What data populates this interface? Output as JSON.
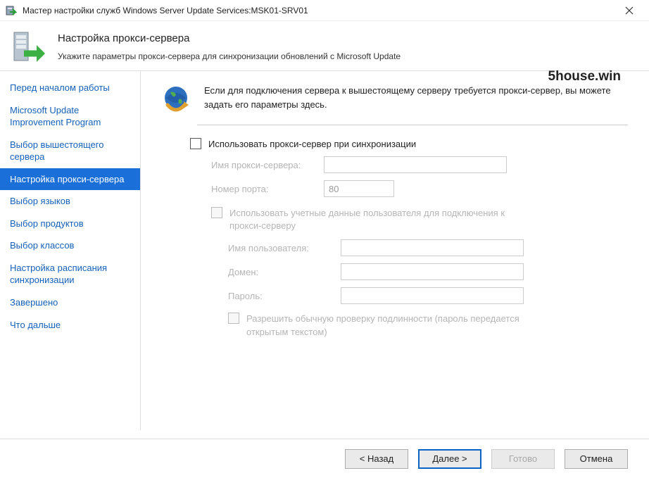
{
  "titlebar": {
    "title": "Мастер настройки служб Windows Server Update Services:MSK01-SRV01"
  },
  "header": {
    "page_title": "Настройка прокси-сервера",
    "page_subtitle": "Укажите параметры прокси-сервера для синхронизации обновлений с Microsoft Update"
  },
  "watermark": "5house.win",
  "sidebar": {
    "items": [
      {
        "label": "Перед началом работы"
      },
      {
        "label": "Microsoft Update Improvement Program"
      },
      {
        "label": "Выбор вышестоящего сервера"
      },
      {
        "label": "Настройка прокси-сервера",
        "selected": true
      },
      {
        "label": "Выбор языков"
      },
      {
        "label": "Выбор продуктов"
      },
      {
        "label": "Выбор классов"
      },
      {
        "label": "Настройка расписания синхронизации"
      },
      {
        "label": "Завершено"
      },
      {
        "label": "Что дальше"
      }
    ]
  },
  "content": {
    "intro": "Если для подключения сервера к вышестоящему серверу требуется прокси-сервер, вы можете задать его параметры здесь.",
    "use_proxy_label": "Использовать прокси-сервер при синхронизации",
    "proxy_name_label": "Имя прокси-сервера:",
    "port_label": "Номер порта:",
    "port_value": "80",
    "use_creds_label": "Использовать учетные данные пользователя для подключения к прокси-серверу",
    "username_label": "Имя пользователя:",
    "domain_label": "Домен:",
    "password_label": "Пароль:",
    "allow_basic_label": "Разрешить обычную проверку подлинности (пароль передается открытым текстом)"
  },
  "footer": {
    "back": "< Назад",
    "next": "Далее >",
    "finish": "Готово",
    "cancel": "Отмена"
  }
}
